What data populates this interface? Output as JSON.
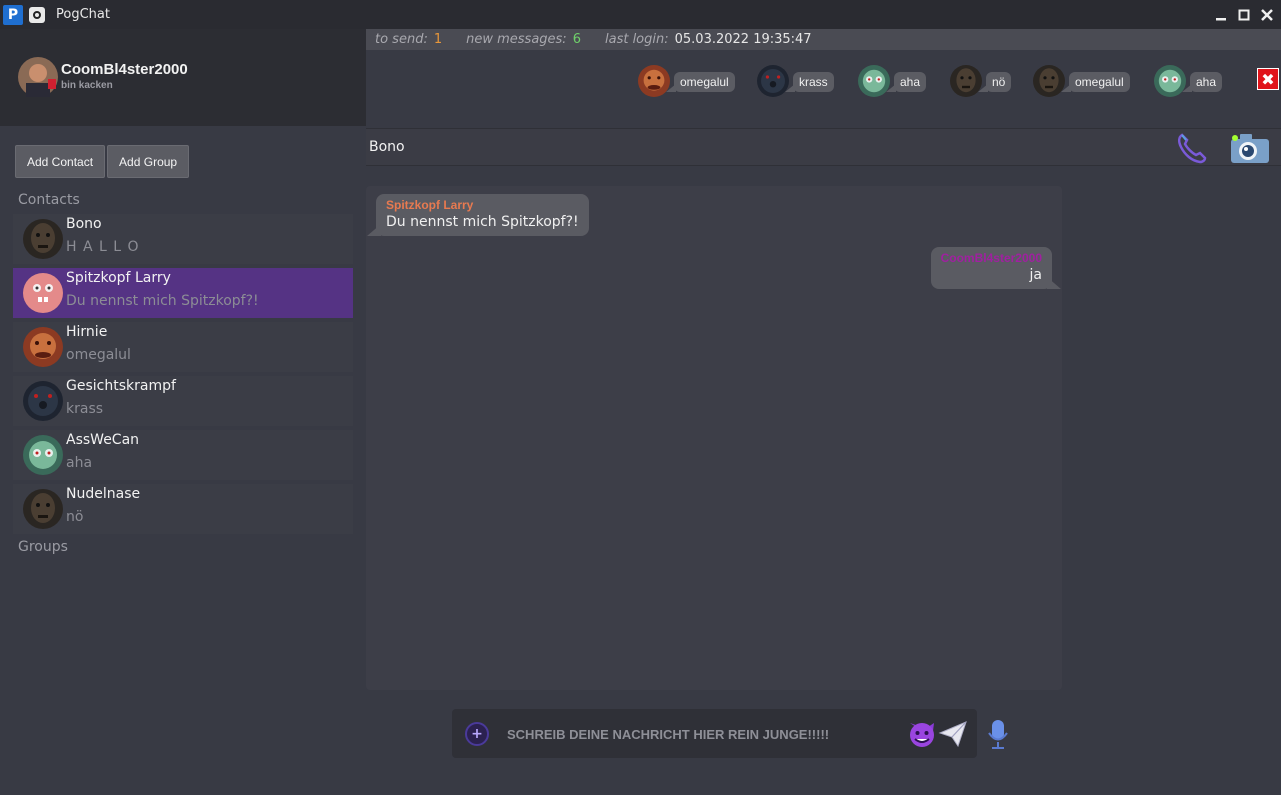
{
  "window": {
    "title": "PogChat",
    "app_icon_letter": "P"
  },
  "profile": {
    "username": "CoomBl4ster2000",
    "status": "bin kacken"
  },
  "stats": {
    "to_send_label": "to send:",
    "to_send": "1",
    "new_messages_label": "new messages:",
    "new_messages": "6",
    "last_login_label": "last login:",
    "last_login": "05.03.2022 19:35:47"
  },
  "bubbles": [
    {
      "text": "omegalul",
      "avatar": "orange-face"
    },
    {
      "text": "krass",
      "avatar": "dark-blob"
    },
    {
      "text": "aha",
      "avatar": "green-squid"
    },
    {
      "text": "nö",
      "avatar": "dark-face"
    },
    {
      "text": "omegalul",
      "avatar": "dark-face"
    },
    {
      "text": "aha",
      "avatar": "green-squid"
    }
  ],
  "sidebar": {
    "add_contact": "Add Contact",
    "add_group": "Add Group",
    "contacts_title": "Contacts",
    "groups_title": "Groups",
    "contacts": [
      {
        "name": "Bono",
        "last": "H A L L O",
        "avatar": "dark-face"
      },
      {
        "name": "Spitzkopf Larry",
        "last": "Du nennst mich Spitzkopf?!",
        "avatar": "pink-larry",
        "active": true
      },
      {
        "name": "Hirnie",
        "last": "omegalul",
        "avatar": "orange-face"
      },
      {
        "name": "Gesichtskrampf",
        "last": "krass",
        "avatar": "dark-blob"
      },
      {
        "name": "AssWeCan",
        "last": "aha",
        "avatar": "green-squid"
      },
      {
        "name": "Nudelnase",
        "last": "nö",
        "avatar": "dark-face"
      }
    ]
  },
  "chat": {
    "contact_name": "Bono",
    "messages": [
      {
        "sender": "Spitzkopf Larry",
        "text": "Du nennst mich Spitzkopf?!",
        "color": "#e87a50",
        "dir": "in"
      },
      {
        "sender": "CoomBl4ster2000",
        "text": "ja",
        "color": "#a020a0",
        "dir": "out"
      }
    ]
  },
  "input": {
    "placeholder": "SCHREIB DEINE NACHRICHT HIER REIN JUNGE!!!!!"
  },
  "colors": {
    "active_contact": "#553384",
    "close_button": "#e0141b"
  }
}
